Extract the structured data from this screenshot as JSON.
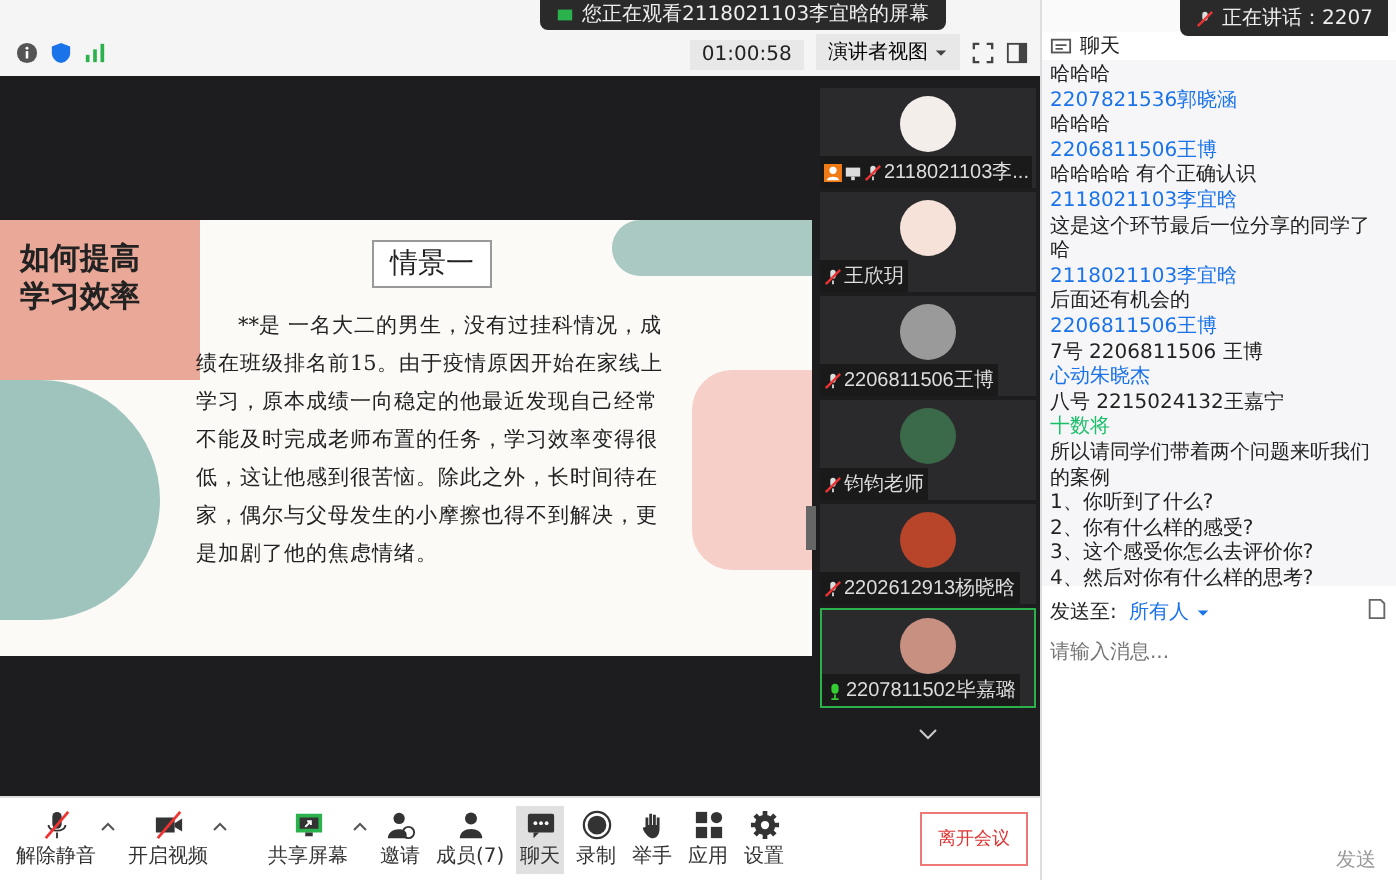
{
  "banner": {
    "text": "您正在观看2118021103李宜晗的屏幕"
  },
  "speaking": {
    "text": "正在讲话：2207"
  },
  "top_bar": {
    "timer": "01:00:58",
    "view_button": "演讲者视图"
  },
  "slide": {
    "title": "如何提高学习效率",
    "heading": "情景一",
    "paragraph": "**是 一名大二的男生，没有过挂科情况，成绩在班级排名前15。由于疫情原因开始在家线上学习，原本成绩一向稳定的他最近发现自己经常不能及时完成老师布置的任务，学习效率变得很低，这让他感到很苦恼。除此之外，长时间待在家，偶尔与父母发生的小摩擦也得不到解决，更是加剧了他的焦虑情绪。"
  },
  "participants": [
    {
      "name": "2118021103李...",
      "host": true,
      "sharing": true,
      "muted": true,
      "speaking": false,
      "color": "#f4eeea"
    },
    {
      "name": "王欣玥",
      "host": false,
      "sharing": false,
      "muted": true,
      "speaking": false,
      "color": "#f7e2da"
    },
    {
      "name": "2206811506王博",
      "host": false,
      "sharing": false,
      "muted": true,
      "speaking": false,
      "color": "#9a9a9a"
    },
    {
      "name": "钧钧老师",
      "host": false,
      "sharing": false,
      "muted": true,
      "speaking": false,
      "color": "#3a6a4a"
    },
    {
      "name": "2202612913杨晓晗",
      "host": false,
      "sharing": false,
      "muted": true,
      "speaking": false,
      "color": "#b8452a"
    },
    {
      "name": "2207811502毕嘉璐",
      "host": false,
      "sharing": false,
      "muted": false,
      "speaking": true,
      "color": "#c89080"
    }
  ],
  "chat": {
    "title": "聊天",
    "messages": [
      {
        "kind": "text",
        "text": "哈哈哈"
      },
      {
        "kind": "name",
        "text": "2207821536郭晓涵"
      },
      {
        "kind": "text",
        "text": "哈哈哈"
      },
      {
        "kind": "name",
        "text": "2206811506王博"
      },
      {
        "kind": "text",
        "text": "哈哈哈哈 有个正确认识"
      },
      {
        "kind": "name",
        "text": "2118021103李宜晗"
      },
      {
        "kind": "text",
        "text": "这是这个环节最后一位分享的同学了哈"
      },
      {
        "kind": "name",
        "text": "2118021103李宜晗"
      },
      {
        "kind": "text",
        "text": "后面还有机会的"
      },
      {
        "kind": "name",
        "text": "2206811506王博"
      },
      {
        "kind": "text",
        "text": "7号 2206811506 王博"
      },
      {
        "kind": "name",
        "text": "心动朱晓杰"
      },
      {
        "kind": "text",
        "text": "八号 2215024132王嘉宁"
      },
      {
        "kind": "host",
        "text": "十数将"
      },
      {
        "kind": "text",
        "text": "所以请同学们带着两个问题来听我们的案例"
      },
      {
        "kind": "text",
        "text": "1、你听到了什么?"
      },
      {
        "kind": "text",
        "text": "2、你有什么样的感受?"
      },
      {
        "kind": "text",
        "text": "3、这个感受你怎么去评价你?"
      },
      {
        "kind": "text",
        "text": "4、然后对你有什么样的思考?"
      }
    ],
    "send_to_label": "发送至:",
    "send_to_value": "所有人",
    "placeholder": "请输入消息...",
    "send_button": "发送"
  },
  "toolbar": [
    {
      "kind": "mic",
      "label": "解除静音",
      "menu": true,
      "selected": false
    },
    {
      "kind": "camera",
      "label": "开启视频",
      "menu": true,
      "selected": false
    },
    {
      "kind": "share",
      "label": "共享屏幕",
      "menu": true,
      "selected": false
    },
    {
      "kind": "invite",
      "label": "邀请",
      "menu": false,
      "selected": false
    },
    {
      "kind": "members",
      "label": "成员(7)",
      "menu": false,
      "selected": false
    },
    {
      "kind": "chat",
      "label": "聊天",
      "menu": false,
      "selected": true
    },
    {
      "kind": "record",
      "label": "录制",
      "menu": false,
      "selected": false
    },
    {
      "kind": "hand",
      "label": "举手",
      "menu": false,
      "selected": false
    },
    {
      "kind": "apps",
      "label": "应用",
      "menu": false,
      "selected": false
    },
    {
      "kind": "settings",
      "label": "设置",
      "menu": false,
      "selected": false
    }
  ],
  "leave_button": "离开会议"
}
